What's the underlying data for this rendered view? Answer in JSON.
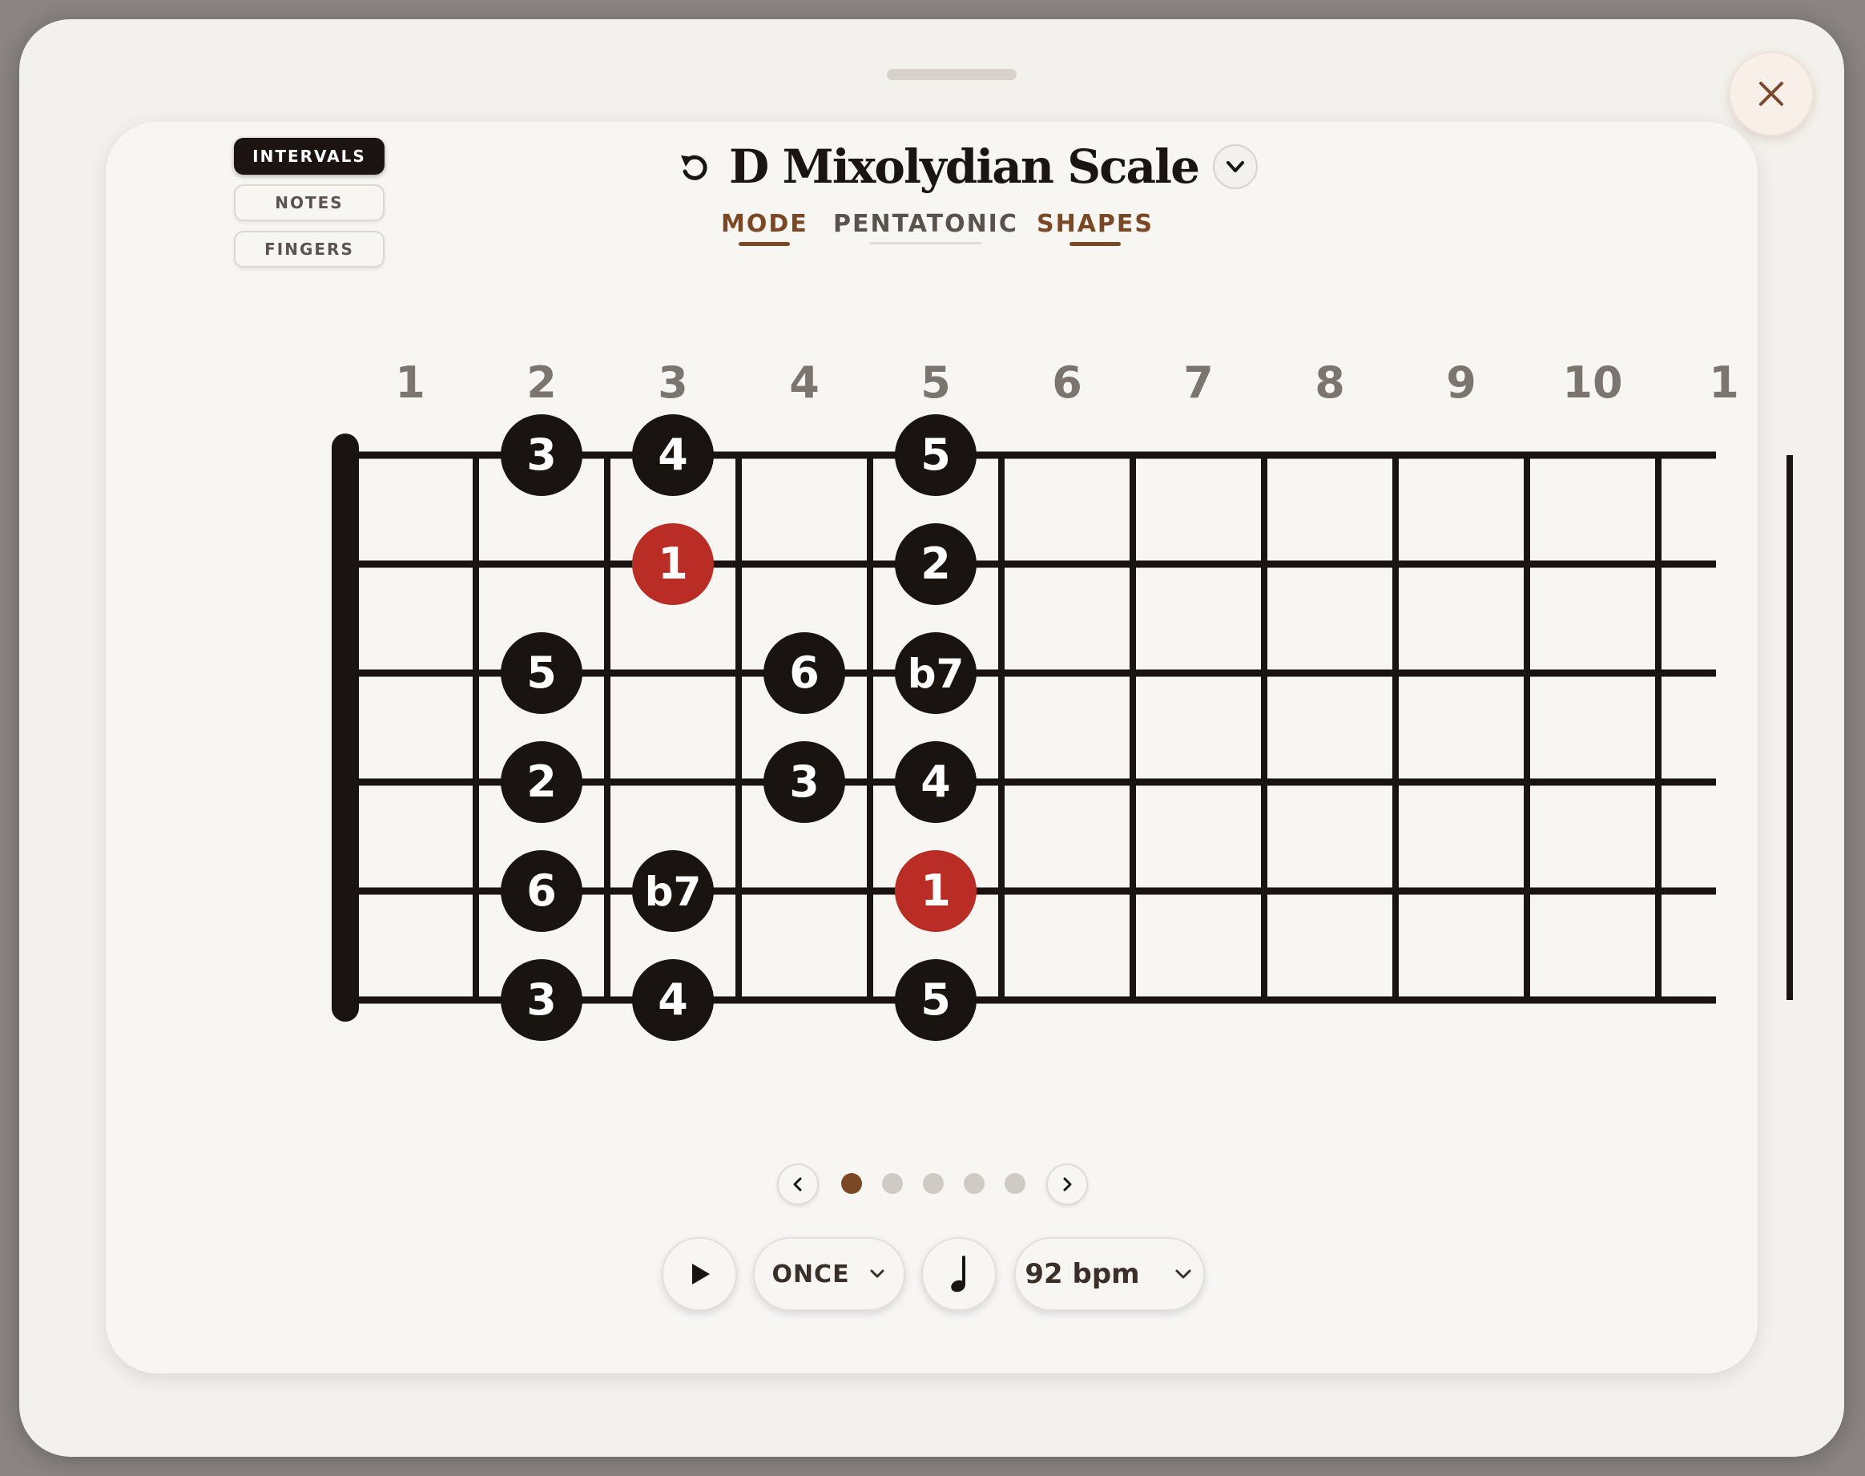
{
  "view_modes": [
    {
      "label": "INTERVALS",
      "active": true
    },
    {
      "label": "NOTES",
      "active": false
    },
    {
      "label": "FINGERS",
      "active": false
    }
  ],
  "title": "D Mixolydian Scale",
  "tabs": [
    {
      "label": "MODE",
      "active": true
    },
    {
      "label": "PENTATONIC",
      "active": false
    },
    {
      "label": "SHAPES",
      "active": true
    }
  ],
  "fret_numbers": [
    "1",
    "2",
    "3",
    "4",
    "5",
    "6",
    "7",
    "8",
    "9",
    "10",
    "1"
  ],
  "notes": [
    {
      "string": 1,
      "fret": 2,
      "label": "3",
      "root": false
    },
    {
      "string": 1,
      "fret": 3,
      "label": "4",
      "root": false
    },
    {
      "string": 1,
      "fret": 5,
      "label": "5",
      "root": false
    },
    {
      "string": 2,
      "fret": 3,
      "label": "1",
      "root": true
    },
    {
      "string": 2,
      "fret": 5,
      "label": "2",
      "root": false
    },
    {
      "string": 3,
      "fret": 2,
      "label": "5",
      "root": false
    },
    {
      "string": 3,
      "fret": 4,
      "label": "6",
      "root": false
    },
    {
      "string": 3,
      "fret": 5,
      "label": "b7",
      "root": false
    },
    {
      "string": 4,
      "fret": 2,
      "label": "2",
      "root": false
    },
    {
      "string": 4,
      "fret": 4,
      "label": "3",
      "root": false
    },
    {
      "string": 4,
      "fret": 5,
      "label": "4",
      "root": false
    },
    {
      "string": 5,
      "fret": 2,
      "label": "6",
      "root": false
    },
    {
      "string": 5,
      "fret": 3,
      "label": "b7",
      "root": false
    },
    {
      "string": 5,
      "fret": 5,
      "label": "1",
      "root": true
    },
    {
      "string": 6,
      "fret": 2,
      "label": "3",
      "root": false
    },
    {
      "string": 6,
      "fret": 3,
      "label": "4",
      "root": false
    },
    {
      "string": 6,
      "fret": 5,
      "label": "5",
      "root": false
    }
  ],
  "pager": {
    "total": 5,
    "current": 1
  },
  "controls": {
    "loop_label": "ONCE",
    "tempo_label": "92 bpm"
  },
  "icons": {
    "close": "close-icon",
    "reset": "reset-icon",
    "dropdown": "chevron-down-icon",
    "play": "play-icon",
    "metronome": "quarter-note-icon",
    "prev": "chevron-left-icon",
    "next": "chevron-right-icon"
  },
  "colors": {
    "accent": "#7a4824",
    "root_note": "#b92d25",
    "note": "#1a1411",
    "inactive_dot": "#cfcac4"
  }
}
